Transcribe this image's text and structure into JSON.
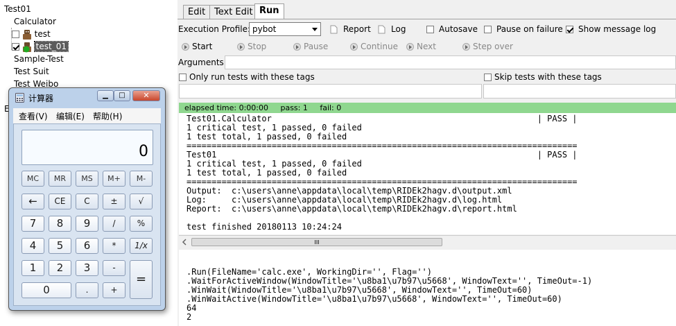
{
  "tree": {
    "items": [
      {
        "label": "Test01"
      },
      {
        "label": "Calculator"
      },
      {
        "label": "test"
      },
      {
        "label": "test_01"
      },
      {
        "label": "Sample-Test"
      },
      {
        "label": "Test Suit"
      },
      {
        "label": "Test Weibo"
      },
      {
        "label": "E"
      }
    ]
  },
  "tabs": [
    {
      "label": "Edit"
    },
    {
      "label": "Text Edit"
    },
    {
      "label": "Run",
      "active": true
    }
  ],
  "run": {
    "profile_label": "Execution Profile:",
    "profile_value": "pybot",
    "report_label": "Report",
    "log_label": "Log",
    "autosave_label": "Autosave",
    "autosave_checked": false,
    "pause_on_failure_label": "Pause on failure",
    "pause_on_failure_checked": false,
    "show_message_log_label": "Show message log",
    "show_message_log_checked": true,
    "controls": {
      "start": "Start",
      "stop": "Stop",
      "pause": "Pause",
      "continue": "Continue",
      "next": "Next",
      "step_over": "Step over"
    },
    "arguments_label": "Arguments:",
    "only_tags_label": "Only run tests with these tags",
    "skip_tags_label": "Skip tests with these tags",
    "status": {
      "text": "elapsed time: 0:00:00     pass: 1     fail: 0",
      "color": "#8fd78f"
    },
    "output_lines": [
      "Test01.Calculator                                                     | PASS |",
      "1 critical test, 1 passed, 0 failed",
      "1 test total, 1 passed, 0 failed",
      "==============================================================================",
      "Test01                                                                | PASS |",
      "1 critical test, 1 passed, 0 failed",
      "1 test total, 1 passed, 0 failed",
      "==============================================================================",
      "Output:  c:\\users\\anne\\appdata\\local\\temp\\RIDEk2hagv.d\\output.xml",
      "Log:     c:\\users\\anne\\appdata\\local\\temp\\RIDEk2hagv.d\\log.html",
      "Report:  c:\\users\\anne\\appdata\\local\\temp\\RIDEk2hagv.d\\report.html",
      "",
      "test finished 20180113 10:24:24"
    ],
    "scroll_grip": "III",
    "log_lines": [
      "",
      "",
      ".Run(FileName='calc.exe', WorkingDir='', Flag='')",
      ".WaitForActiveWindow(WindowTitle='\\u8ba1\\u7b97\\u5668', WindowText='', TimeOut=-1)",
      ".WinWait(WindowTitle='\\u8ba1\\u7b97\\u5668', WindowText='', TimeOut=60)",
      ".WinWaitActive(WindowTitle='\\u8ba1\\u7b97\\u5668', WindowText='', TimeOut=60)",
      "64",
      "2"
    ]
  },
  "calculator": {
    "title": "计算器",
    "menu": [
      "查看(V)",
      "编辑(E)",
      "帮助(H)"
    ],
    "display": "0",
    "keys": [
      [
        "MC",
        "MR",
        "MS",
        "M+",
        "M-"
      ],
      [
        "←",
        "CE",
        "C",
        "±",
        "√"
      ],
      [
        "7",
        "8",
        "9",
        "/",
        "%"
      ],
      [
        "4",
        "5",
        "6",
        "*",
        "1/x"
      ],
      [
        "1",
        "2",
        "3",
        "-",
        "="
      ],
      [
        "0",
        ".",
        "+"
      ]
    ]
  }
}
